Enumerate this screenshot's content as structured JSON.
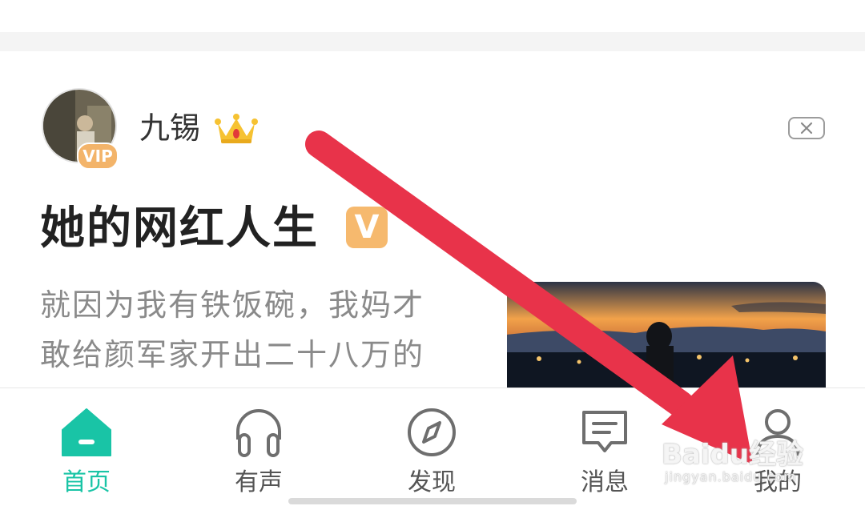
{
  "feed_card": {
    "author": {
      "name": "九锡",
      "avatar_badge": "VIP"
    },
    "title": "她的网红人生",
    "title_badge": "V",
    "excerpt_lines": [
      "就因为我有铁饭碗，我妈才",
      "敢给颜军家开出二十八万的"
    ]
  },
  "tabbar": {
    "items": [
      {
        "label": "首页",
        "icon": "home-icon",
        "active": true
      },
      {
        "label": "有声",
        "icon": "headphones-icon",
        "active": false
      },
      {
        "label": "发现",
        "icon": "compass-icon",
        "active": false
      },
      {
        "label": "消息",
        "icon": "message-icon",
        "active": false
      },
      {
        "label": "我的",
        "icon": "user-icon",
        "active": false
      }
    ]
  },
  "watermark": {
    "brand": "Baidu经验",
    "url": "jingyan.baidu.com"
  },
  "colors": {
    "accent": "#19c4a6",
    "annotation_arrow": "#e8334a",
    "vip": "#f3b46a"
  }
}
